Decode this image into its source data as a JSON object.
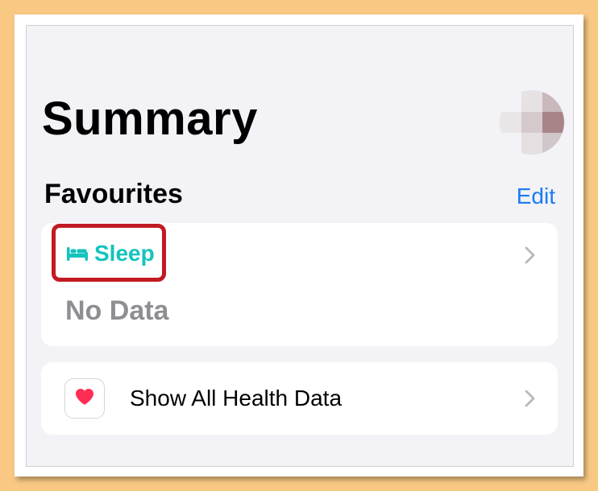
{
  "header": {
    "title": "Summary"
  },
  "favourites": {
    "section_title": "Favourites",
    "edit_label": "Edit",
    "sleep_card": {
      "category_label": "Sleep",
      "value_text": "No Data",
      "icon": "bed-icon"
    }
  },
  "health_row": {
    "label": "Show All Health Data",
    "icon": "heart-icon"
  },
  "colors": {
    "accent_blue": "#1a7cf0",
    "sleep_teal": "#14c3bd",
    "highlight_red": "#c21a23",
    "heart_red": "#ff2d55",
    "secondary_gray": "#8e8e93"
  }
}
